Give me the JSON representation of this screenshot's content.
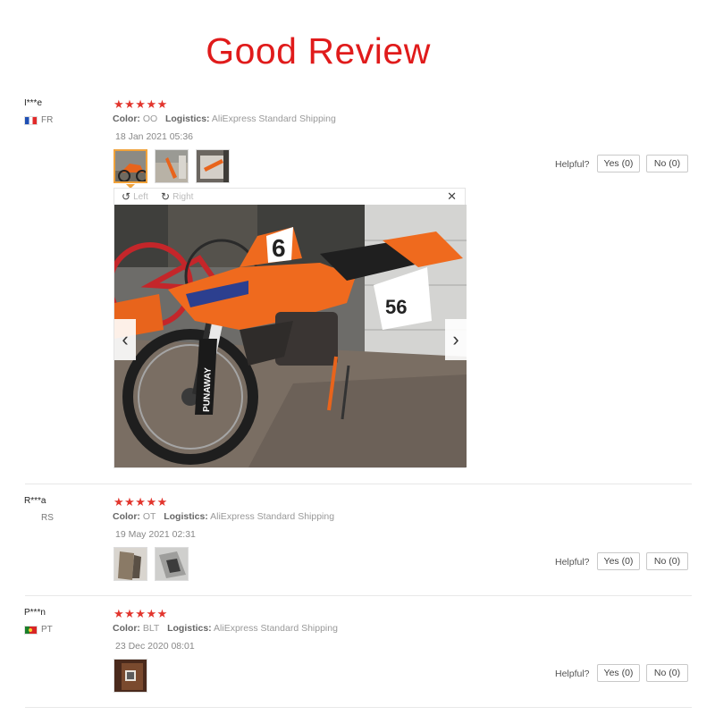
{
  "page": {
    "title": "Good Review"
  },
  "reviews": [
    {
      "user": "I***e",
      "country": "FR",
      "stars": "★★★★★",
      "color_label": "Color:",
      "color_value": "OO",
      "logistics_label": "Logistics:",
      "logistics_value": "AliExpress Standard Shipping",
      "date": "18 Jan 2021 05:36",
      "helpful_label": "Helpful?",
      "yes_label": "Yes (0)",
      "no_label": "No (0)"
    },
    {
      "user": "R***a",
      "country": "RS",
      "stars": "★★★★★",
      "color_label": "Color:",
      "color_value": "OT",
      "logistics_label": "Logistics:",
      "logistics_value": "AliExpress Standard Shipping",
      "date": "19 May 2021 02:31",
      "helpful_label": "Helpful?",
      "yes_label": "Yes (0)",
      "no_label": "No (0)"
    },
    {
      "user": "P***n",
      "country": "PT",
      "stars": "★★★★★",
      "color_label": "Color:",
      "color_value": "BLT",
      "logistics_label": "Logistics:",
      "logistics_value": "AliExpress Standard Shipping",
      "date": "23 Dec 2020 08:01",
      "helpful_label": "Helpful?",
      "yes_label": "Yes (0)",
      "no_label": "No (0)"
    }
  ],
  "viewer": {
    "rotate_left": "Left",
    "rotate_right": "Right",
    "close_icon": "close-icon",
    "prev_icon": "chevron-left-icon",
    "next_icon": "chevron-right-icon",
    "bike_numbers": [
      "6",
      "56"
    ],
    "sticker_text": "PUNAWAY"
  },
  "colors": {
    "title": "#e01b1b",
    "stars": "#e2352d",
    "active_thumb_border": "#f0a23b"
  }
}
